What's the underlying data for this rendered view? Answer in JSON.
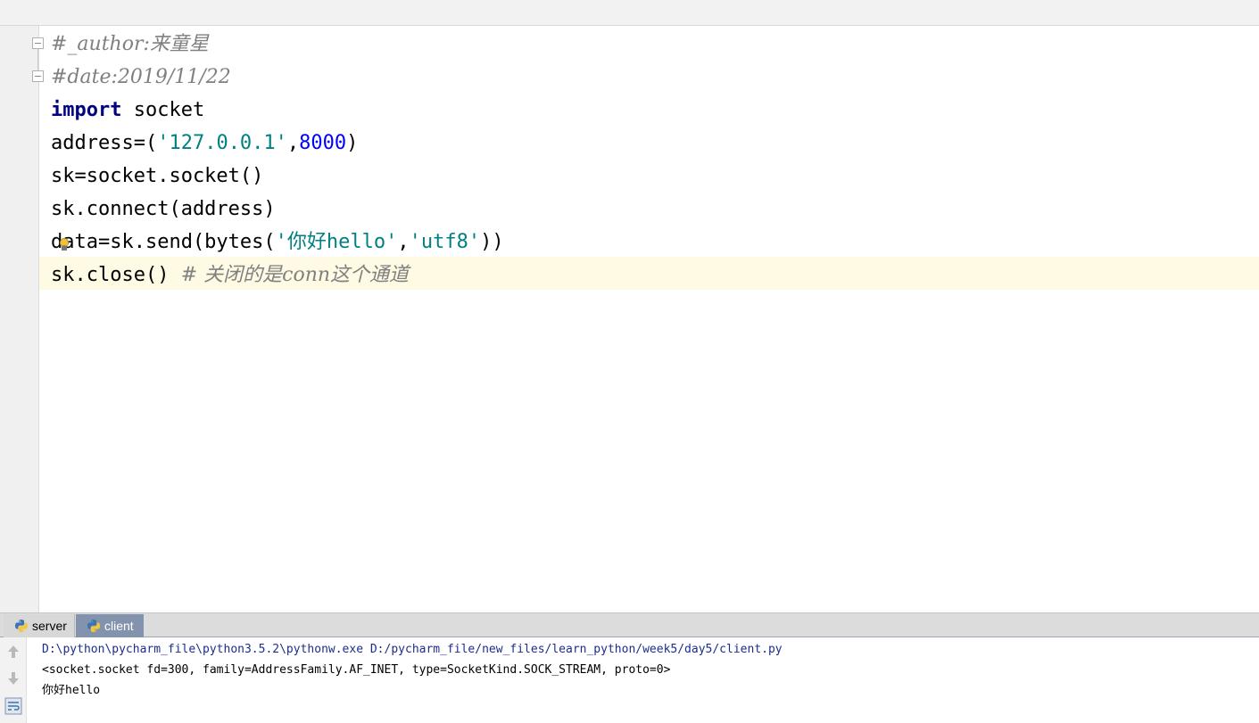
{
  "editor": {
    "lines": [
      [
        {
          "cls": "cm",
          "text": "#_author:来童星"
        }
      ],
      [
        {
          "cls": "cm",
          "text": "#date:2019/11/22"
        }
      ],
      [
        {
          "cls": "kw",
          "text": "import"
        },
        {
          "cls": "",
          "text": " socket"
        }
      ],
      [
        {
          "cls": "",
          "text": "address=("
        },
        {
          "cls": "str",
          "text": "'127.0.0.1'"
        },
        {
          "cls": "",
          "text": ","
        },
        {
          "cls": "num",
          "text": "8000"
        },
        {
          "cls": "",
          "text": ")"
        }
      ],
      [
        {
          "cls": "",
          "text": "sk=socket.socket()"
        }
      ],
      [
        {
          "cls": "",
          "text": "sk.connect(address)"
        }
      ],
      [
        {
          "cls": "",
          "text": "data=sk.send(bytes("
        },
        {
          "cls": "str",
          "text": "'你好hello'"
        },
        {
          "cls": "",
          "text": ","
        },
        {
          "cls": "str",
          "text": "'utf8'"
        },
        {
          "cls": "",
          "text": "))"
        }
      ],
      [
        {
          "cls": "",
          "text": "sk.close() "
        },
        {
          "cls": "cm",
          "text": "# 关闭的是conn这个通道"
        }
      ]
    ],
    "colors": {
      "keyword": "#000080",
      "string": "#008080",
      "number": "#0000ff",
      "comment": "#808080",
      "current_line": "#fffae3"
    }
  },
  "run": {
    "tabs": [
      {
        "label": "server",
        "icon": "python-icon",
        "active": false
      },
      {
        "label": "client",
        "icon": "python-icon",
        "active": true
      }
    ],
    "toolbar": [
      "arrow-up-icon",
      "arrow-down-icon",
      "soft-wrap-icon"
    ],
    "console": {
      "command": "D:\\python\\pycharm_file\\python3.5.2\\pythonw.exe D:/pycharm_file/new_files/learn_python/week5/day5/client.py",
      "output": [
        "<socket.socket fd=300, family=AddressFamily.AF_INET, type=SocketKind.SOCK_STREAM, proto=0>",
        "你好hello"
      ]
    },
    "colors": {
      "active_tab": "#8393ad",
      "command_text": "#1c2d8c"
    }
  }
}
